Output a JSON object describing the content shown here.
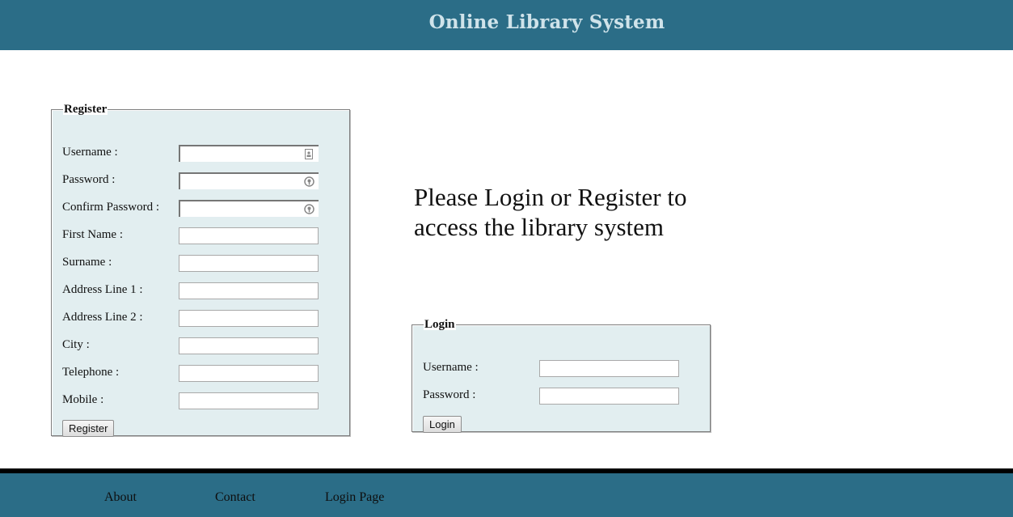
{
  "header": {
    "title": "Online Library System"
  },
  "register": {
    "legend": "Register",
    "fields": [
      {
        "label": "Username :"
      },
      {
        "label": "Password :"
      },
      {
        "label": "Confirm Password :"
      },
      {
        "label": "First Name :"
      },
      {
        "label": "Surname :"
      },
      {
        "label": "Address Line 1 :"
      },
      {
        "label": "Address Line 2 :"
      },
      {
        "label": "City :"
      },
      {
        "label": "Telephone :"
      },
      {
        "label": "Mobile :"
      }
    ],
    "button": "Register"
  },
  "message": "Please Login or Register to access the library system",
  "login": {
    "legend": "Login",
    "fields": [
      {
        "label": "Username :"
      },
      {
        "label": "Password :"
      }
    ],
    "button": "Login"
  },
  "footer": {
    "links": [
      {
        "label": "About"
      },
      {
        "label": "Contact"
      },
      {
        "label": "Login Page"
      }
    ]
  },
  "colors": {
    "header_bg": "#2b6d87",
    "panel_bg": "#e2eef0",
    "header_text": "#cfe3ea"
  },
  "icons": {
    "username_field": "contact-card-icon",
    "password_field": "key-icon"
  }
}
